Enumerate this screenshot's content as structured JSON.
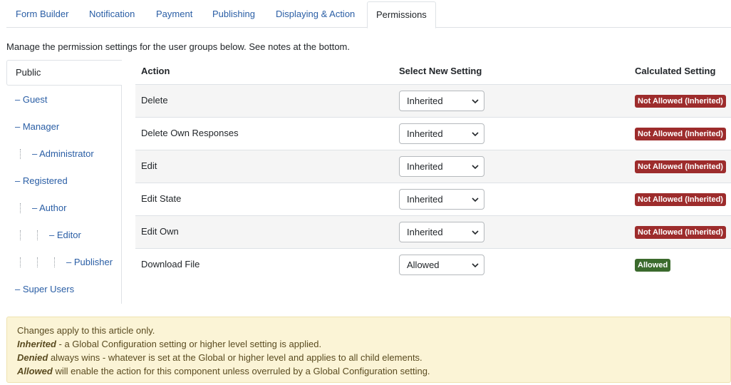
{
  "tabs": [
    {
      "label": "Form Builder"
    },
    {
      "label": "Notification"
    },
    {
      "label": "Payment"
    },
    {
      "label": "Publishing"
    },
    {
      "label": "Displaying & Action"
    },
    {
      "label": "Permissions",
      "active": true
    }
  ],
  "intro": "Manage the permission settings for the user groups below. See notes at the bottom.",
  "groups": {
    "active": "Public",
    "items": [
      {
        "label": "– Guest",
        "depth": 0
      },
      {
        "label": "– Manager",
        "depth": 0
      },
      {
        "label": "– Administrator",
        "depth": 1
      },
      {
        "label": "– Registered",
        "depth": 0
      },
      {
        "label": "– Author",
        "depth": 1
      },
      {
        "label": "– Editor",
        "depth": 2
      },
      {
        "label": "– Publisher",
        "depth": 3
      },
      {
        "label": "– Super Users",
        "depth": 0
      }
    ]
  },
  "table": {
    "headers": {
      "action": "Action",
      "select": "Select New Setting",
      "calculated": "Calculated Setting"
    },
    "rows": [
      {
        "action": "Delete",
        "setting": "Inherited",
        "calculated": "Not Allowed (Inherited)",
        "status": "denied"
      },
      {
        "action": "Delete Own Responses",
        "setting": "Inherited",
        "calculated": "Not Allowed (Inherited)",
        "status": "denied"
      },
      {
        "action": "Edit",
        "setting": "Inherited",
        "calculated": "Not Allowed (Inherited)",
        "status": "denied"
      },
      {
        "action": "Edit State",
        "setting": "Inherited",
        "calculated": "Not Allowed (Inherited)",
        "status": "denied"
      },
      {
        "action": "Edit Own",
        "setting": "Inherited",
        "calculated": "Not Allowed (Inherited)",
        "status": "denied"
      },
      {
        "action": "Download File",
        "setting": "Allowed",
        "calculated": "Allowed",
        "status": "allowed"
      }
    ]
  },
  "notes": {
    "line1": "Changes apply to this article only.",
    "line2_bold": "Inherited",
    "line2_rest": " - a Global Configuration setting or higher level setting is applied.",
    "line3_bold": "Denied",
    "line3_rest": " always wins - whatever is set at the Global or higher level and applies to all child elements.",
    "line4_bold": "Allowed",
    "line4_rest": " will enable the action for this component unless overruled by a Global Configuration setting."
  },
  "colors": {
    "link": "#2a5ea5",
    "denied": "#9d2c2c",
    "allowed": "#3b6a2d",
    "notes_bg": "#fbf4d6"
  }
}
